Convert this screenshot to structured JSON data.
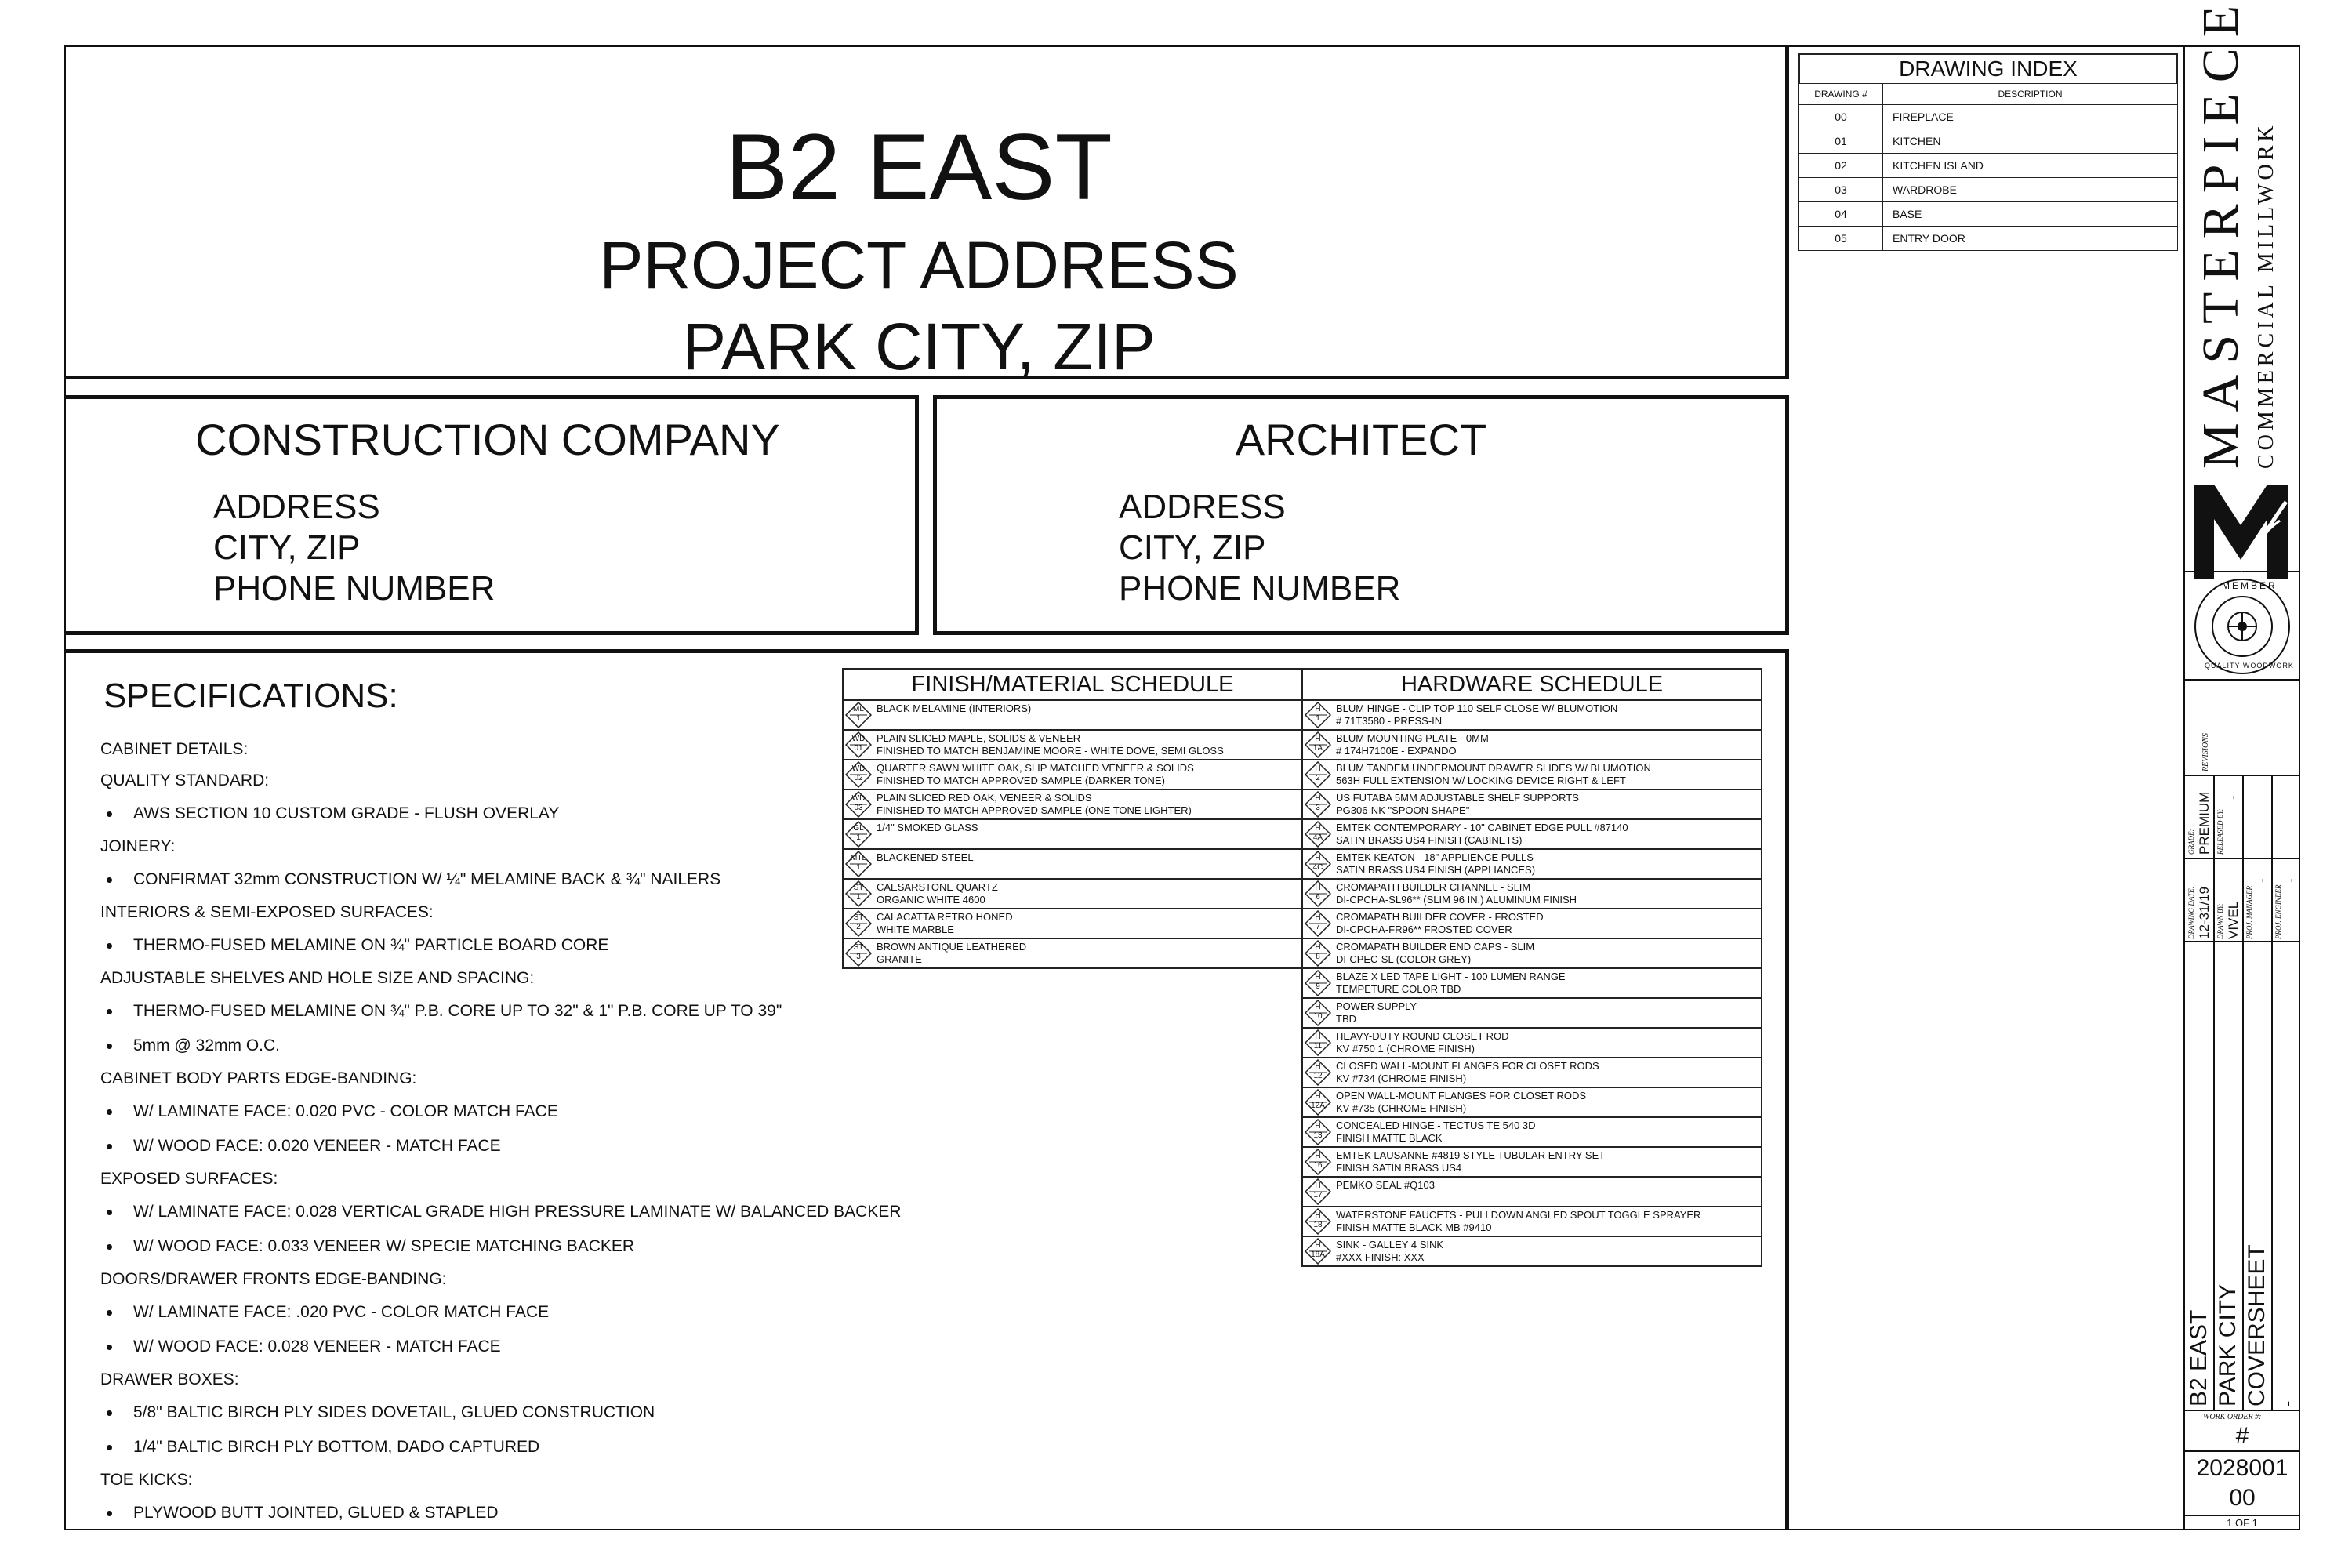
{
  "title": {
    "project_name": "B2 EAST",
    "address_line": "PROJECT ADDRESS",
    "city_line": "PARK CITY, ZIP"
  },
  "contractor": {
    "heading": "CONSTRUCTION COMPANY",
    "address": "ADDRESS",
    "city": "CITY, ZIP",
    "phone": "PHONE NUMBER"
  },
  "architect": {
    "heading": "ARCHITECT",
    "address": "ADDRESS",
    "city": "CITY, ZIP",
    "phone": "PHONE NUMBER"
  },
  "specifications": {
    "heading": "SPECIFICATIONS:",
    "lines": [
      {
        "type": "head",
        "text": "CABINET DETAILS:"
      },
      {
        "type": "head",
        "text": "QUALITY STANDARD:"
      },
      {
        "type": "bullet",
        "text": "AWS SECTION 10 CUSTOM GRADE - FLUSH OVERLAY"
      },
      {
        "type": "head",
        "text": "JOINERY:"
      },
      {
        "type": "bullet",
        "text": "CONFIRMAT 32mm CONSTRUCTION W/ ¼\" MELAMINE BACK & ¾\" NAILERS"
      },
      {
        "type": "head",
        "text": "INTERIORS & SEMI-EXPOSED SURFACES:"
      },
      {
        "type": "bullet",
        "text": "THERMO-FUSED MELAMINE ON ¾\" PARTICLE BOARD CORE"
      },
      {
        "type": "head",
        "text": "ADJUSTABLE SHELVES AND HOLE SIZE AND SPACING:"
      },
      {
        "type": "bullet",
        "text": "THERMO-FUSED MELAMINE ON ¾\" P.B. CORE UP TO 32\" & 1\" P.B. CORE UP TO 39\""
      },
      {
        "type": "bullet",
        "text": "5mm @ 32mm O.C."
      },
      {
        "type": "head",
        "text": "CABINET BODY PARTS EDGE-BANDING:"
      },
      {
        "type": "bullet",
        "text": "W/ LAMINATE FACE:  0.020 PVC - COLOR MATCH FACE"
      },
      {
        "type": "bullet",
        "text": "W/ WOOD FACE:  0.020 VENEER - MATCH FACE"
      },
      {
        "type": "head",
        "text": "EXPOSED SURFACES:"
      },
      {
        "type": "bullet",
        "text": "W/ LAMINATE FACE:  0.028 VERTICAL GRADE HIGH PRESSURE LAMINATE W/ BALANCED BACKER"
      },
      {
        "type": "bullet",
        "text": "W/ WOOD FACE:  0.033 VENEER W/ SPECIE MATCHING BACKER"
      },
      {
        "type": "head",
        "text": "DOORS/DRAWER FRONTS EDGE-BANDING:"
      },
      {
        "type": "bullet",
        "text": "W/ LAMINATE FACE:  .020 PVC - COLOR MATCH FACE"
      },
      {
        "type": "bullet",
        "text": "W/ WOOD FACE:  0.028 VENEER - MATCH FACE"
      },
      {
        "type": "head",
        "text": "DRAWER BOXES:"
      },
      {
        "type": "bullet",
        "text": "5/8\" BALTIC BIRCH PLY SIDES DOVETAIL, GLUED CONSTRUCTION"
      },
      {
        "type": "bullet",
        "text": "1/4\" BALTIC BIRCH PLY BOTTOM, DADO CAPTURED"
      },
      {
        "type": "head",
        "text": "TOE KICKS:"
      },
      {
        "type": "bullet",
        "text": "PLYWOOD BUTT JOINTED, GLUED & STAPLED"
      }
    ]
  },
  "finish_schedule": {
    "heading": "FINISH/MATERIAL SCHEDULE",
    "rows": [
      {
        "tag": "ML",
        "num": "1",
        "desc": [
          "BLACK MELAMINE (INTERIORS)"
        ]
      },
      {
        "tag": "WD",
        "num": "01",
        "desc": [
          "PLAIN SLICED MAPLE, SOLIDS & VENEER",
          "FINISHED TO MATCH BENJAMINE MOORE - WHITE DOVE, SEMI GLOSS"
        ]
      },
      {
        "tag": "WD",
        "num": "02",
        "desc": [
          "QUARTER SAWN WHITE OAK, SLIP MATCHED VENEER & SOLIDS",
          "FINISHED TO MATCH APPROVED SAMPLE (DARKER TONE)"
        ]
      },
      {
        "tag": "WD",
        "num": "03",
        "desc": [
          "PLAIN SLICED RED OAK, VENEER & SOLIDS",
          "FINISHED TO MATCH APPROVED SAMPLE (ONE TONE LIGHTER)"
        ]
      },
      {
        "tag": "GL",
        "num": "1",
        "desc": [
          "1/4\" SMOKED GLASS"
        ]
      },
      {
        "tag": "MTL",
        "num": "1",
        "desc": [
          "BLACKENED STEEL"
        ]
      },
      {
        "tag": "ST",
        "num": "1",
        "desc": [
          "CAESARSTONE QUARTZ",
          "ORGANIC WHITE 4600"
        ]
      },
      {
        "tag": "ST",
        "num": "2",
        "desc": [
          "CALACATTA RETRO HONED",
          "WHITE MARBLE"
        ]
      },
      {
        "tag": "ST",
        "num": "3",
        "desc": [
          "BROWN ANTIQUE LEATHERED",
          "GRANITE"
        ]
      }
    ]
  },
  "hardware_schedule": {
    "heading": "HARDWARE SCHEDULE",
    "rows": [
      {
        "tag": "H",
        "num": "1",
        "desc": [
          "BLUM HINGE - CLIP TOP 110 SELF CLOSE W/ BLUMOTION",
          "# 71T3580 - PRESS-IN"
        ]
      },
      {
        "tag": "H",
        "num": "1A",
        "desc": [
          "BLUM MOUNTING PLATE - 0MM",
          "# 174H7100E - EXPANDO"
        ]
      },
      {
        "tag": "H",
        "num": "2",
        "desc": [
          "BLUM TANDEM UNDERMOUNT DRAWER SLIDES W/ BLUMOTION",
          "563H FULL EXTENSION W/ LOCKING DEVICE RIGHT & LEFT"
        ]
      },
      {
        "tag": "H",
        "num": "3",
        "desc": [
          "US FUTABA 5MM ADJUSTABLE SHELF SUPPORTS",
          "PG306-NK  \"SPOON SHAPE\""
        ]
      },
      {
        "tag": "H",
        "num": "4A",
        "desc": [
          "EMTEK CONTEMPORARY - 10\" CABINET EDGE PULL #87140",
          "SATIN BRASS US4 FINISH (CABINETS)"
        ]
      },
      {
        "tag": "H",
        "num": "4C",
        "desc": [
          "EMTEK KEATON - 18\" APPLIENCE PULLS",
          "SATIN BRASS US4 FINISH (APPLIANCES)"
        ]
      },
      {
        "tag": "H",
        "num": "6",
        "desc": [
          "CROMAPATH BUILDER CHANNEL - SLIM",
          "DI-CPCHA-SL96** (SLIM 96 IN.) ALUMINUM FINISH"
        ]
      },
      {
        "tag": "H",
        "num": "7",
        "desc": [
          "CROMAPATH BUILDER COVER - FROSTED",
          "DI-CPCHA-FR96** FROSTED COVER"
        ]
      },
      {
        "tag": "H",
        "num": "8",
        "desc": [
          "CROMAPATH BUILDER END CAPS - SLIM",
          "DI-CPEC-SL (COLOR GREY)"
        ]
      },
      {
        "tag": "H",
        "num": "9",
        "desc": [
          "BLAZE X LED TAPE LIGHT - 100 LUMEN RANGE",
          "TEMPETURE COLOR TBD"
        ]
      },
      {
        "tag": "H",
        "num": "10",
        "desc": [
          "POWER SUPPLY",
          "TBD"
        ]
      },
      {
        "tag": "H",
        "num": "11",
        "desc": [
          "HEAVY-DUTY ROUND CLOSET ROD",
          "KV #750 1 (CHROME FINISH)"
        ]
      },
      {
        "tag": "H",
        "num": "12",
        "desc": [
          "CLOSED WALL-MOUNT FLANGES FOR CLOSET RODS",
          "KV #734 (CHROME FINISH)"
        ]
      },
      {
        "tag": "H",
        "num": "12A",
        "desc": [
          "OPEN WALL-MOUNT FLANGES FOR CLOSET RODS",
          "KV #735 (CHROME FINISH)"
        ]
      },
      {
        "tag": "H",
        "num": "13",
        "desc": [
          "CONCEALED HINGE - TECTUS TE 540 3D",
          "FINISH MATTE BLACK"
        ]
      },
      {
        "tag": "H",
        "num": "16",
        "desc": [
          "EMTEK LAUSANNE #4819 STYLE TUBULAR ENTRY SET",
          "FINISH SATIN BRASS US4"
        ]
      },
      {
        "tag": "H",
        "num": "17",
        "desc": [
          "PEMKO SEAL #Q103",
          ""
        ]
      },
      {
        "tag": "H",
        "num": "18",
        "desc": [
          "WATERSTONE FAUCETS - PULLDOWN ANGLED SPOUT TOGGLE SPRAYER",
          "FINISH MATTE BLACK MB #9410"
        ]
      },
      {
        "tag": "H",
        "num": "18A",
        "desc": [
          "SINK - GALLEY 4 SINK",
          "#XXX FINISH: XXX"
        ]
      }
    ]
  },
  "drawing_index": {
    "heading": "DRAWING INDEX",
    "col_num": "DRAWING #",
    "col_desc": "DESCRIPTION",
    "rows": [
      {
        "num": "00",
        "desc": "FIREPLACE"
      },
      {
        "num": "01",
        "desc": "KITCHEN"
      },
      {
        "num": "02",
        "desc": "KITCHEN ISLAND"
      },
      {
        "num": "03",
        "desc": "WARDROBE"
      },
      {
        "num": "04",
        "desc": "BASE"
      },
      {
        "num": "05",
        "desc": "ENTRY DOOR"
      }
    ]
  },
  "logo": {
    "brand": "MASTERPIECE",
    "tagline": "COMMERCIAL MILLWORK",
    "member_top": "MEMBER",
    "member_bottom": "QUALITY WOODWORK"
  },
  "title_block": {
    "revisions_label": "REVISIONS",
    "drawing_date_label": "DRAWING DATE:",
    "drawing_date": "12-31/19",
    "grade_label": "GRADE:",
    "grade": "PREMIUM",
    "drawn_by_label": "DRAWN BY:",
    "drawn_by": "VIVEL",
    "released_by_label": "RELEASED BY:",
    "released_by": "-",
    "proj_manager_label": "PROJ. MANAGER",
    "proj_manager": "-",
    "proj_engineer_label": "PROJ. ENGINEER",
    "proj_engineer": "-",
    "project": "B2 EAST",
    "city": "PARK CITY",
    "sheet_name": "COVERSHEET",
    "sheet_dash": "-",
    "work_order_label": "WORK ORDER #:",
    "work_order": "#",
    "job_number": "2028001",
    "sheet_number": "00",
    "sheet_count": "1 OF 1"
  }
}
